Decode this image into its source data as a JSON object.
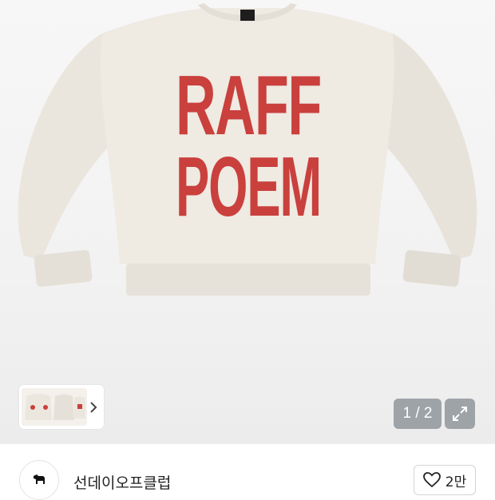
{
  "product": {
    "print_line1": "RAFF",
    "print_line2": "POEM",
    "print_color": "#c9403d",
    "garment_color": "#ece7de"
  },
  "gallery": {
    "counter": "1 / 2",
    "thumbnail_icon": "thumbnail-image",
    "next_icon": "chevron-right-icon",
    "expand_icon": "expand-arrows-icon"
  },
  "seller": {
    "name": "선데이오프클럽",
    "avatar_icon": "dog-logo-icon"
  },
  "like": {
    "count": "2만",
    "icon": "heart-outline-icon"
  }
}
